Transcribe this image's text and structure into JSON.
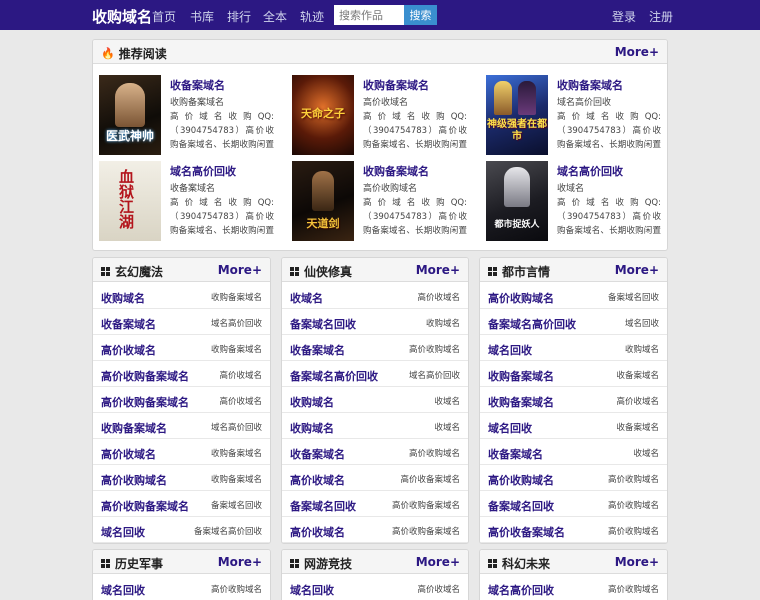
{
  "nav": {
    "brand": "收购域名",
    "links": [
      "首页",
      "书库",
      "排行",
      "全本",
      "轨迹"
    ],
    "search_placeholder": "搜索作品",
    "search_button": "搜索",
    "login": "登录",
    "register": "注册"
  },
  "recommend": {
    "title": "推荐阅读",
    "more": "More+",
    "books": [
      {
        "cover_text": "医武神帅",
        "title": "收备案域名",
        "author": "收购备案域名",
        "desc": "高 价 域 名 收 购 QQ:（3904754783）高价收购备案域名、长期收购闲置老域名、"
      },
      {
        "cover_text": "天命之子",
        "title": "收购备案域名",
        "author": "高价收域名",
        "desc": "高 价 域 名 收 购 QQ:（3904754783）高价收购备案域名、长期收购闲置老域名、"
      },
      {
        "cover_text": "神级强者在都市",
        "title": "收购备案域名",
        "author": "域名高价回收",
        "desc": "高 价 域 名 收 购 QQ:（3904754783）高价收购备案域名、长期收购闲置老域名、"
      },
      {
        "cover_text": "血狱江湖",
        "title": "域名高价回收",
        "author": "收备案域名",
        "desc": "高 价 域 名 收 购 QQ:（3904754783）高价收购备案域名、长期收购闲置老域名、"
      },
      {
        "cover_text": "天道剑",
        "title": "收购备案域名",
        "author": "高价收购域名",
        "desc": "高 价 域 名 收 购 QQ:（3904754783）高价收购备案域名、长期收购闲置老域名、"
      },
      {
        "cover_text": "都市捉妖人",
        "title": "域名高价回收",
        "author": "收域名",
        "desc": "高 价 域 名 收 购 QQ:（3904754783）高价收购备案域名、长期收购闲置老域名、"
      }
    ]
  },
  "categories": [
    {
      "title": "玄幻魔法",
      "more": "More+",
      "items": [
        {
          "title": "收购域名",
          "author": "收购备案域名"
        },
        {
          "title": "收备案域名",
          "author": "域名高价回收"
        },
        {
          "title": "高价收域名",
          "author": "收购备案域名"
        },
        {
          "title": "高价收购备案域名",
          "author": "高价收域名"
        },
        {
          "title": "高价收购备案域名",
          "author": "高价收域名"
        },
        {
          "title": "收购备案域名",
          "author": "域名高价回收"
        },
        {
          "title": "高价收域名",
          "author": "收购备案域名"
        },
        {
          "title": "高价收购域名",
          "author": "收购备案域名"
        },
        {
          "title": "高价收购备案域名",
          "author": "备案域名回收"
        },
        {
          "title": "域名回收",
          "author": "备案域名高价回收"
        }
      ]
    },
    {
      "title": "仙侠修真",
      "more": "More+",
      "items": [
        {
          "title": "收域名",
          "author": "高价收域名"
        },
        {
          "title": "备案域名回收",
          "author": "收购域名"
        },
        {
          "title": "收备案域名",
          "author": "高价收购域名"
        },
        {
          "title": "备案域名高价回收",
          "author": "域名高价回收"
        },
        {
          "title": "收购域名",
          "author": "收域名"
        },
        {
          "title": "收购域名",
          "author": "收域名"
        },
        {
          "title": "收备案域名",
          "author": "高价收购域名"
        },
        {
          "title": "高价收域名",
          "author": "高价收备案域名"
        },
        {
          "title": "备案域名回收",
          "author": "高价收购备案域名"
        },
        {
          "title": "高价收域名",
          "author": "高价收购备案域名"
        }
      ]
    },
    {
      "title": "都市言情",
      "more": "More+",
      "items": [
        {
          "title": "高价收购域名",
          "author": "备案域名回收"
        },
        {
          "title": "备案域名高价回收",
          "author": "域名回收"
        },
        {
          "title": "域名回收",
          "author": "收购域名"
        },
        {
          "title": "收购备案域名",
          "author": "收备案域名"
        },
        {
          "title": "收购备案域名",
          "author": "高价收域名"
        },
        {
          "title": "域名回收",
          "author": "收备案域名"
        },
        {
          "title": "收备案域名",
          "author": "收域名"
        },
        {
          "title": "高价收购域名",
          "author": "高价收购域名"
        },
        {
          "title": "备案域名回收",
          "author": "高价收购域名"
        },
        {
          "title": "高价收备案域名",
          "author": "高价收购域名"
        }
      ]
    },
    {
      "title": "历史军事",
      "more": "More+",
      "items": [
        {
          "title": "域名回收",
          "author": "高价收购域名"
        }
      ]
    },
    {
      "title": "网游竞技",
      "more": "More+",
      "items": [
        {
          "title": "域名回收",
          "author": "高价收域名"
        }
      ]
    },
    {
      "title": "科幻未来",
      "more": "More+",
      "items": [
        {
          "title": "域名高价回收",
          "author": "高价收购域名"
        }
      ]
    }
  ]
}
